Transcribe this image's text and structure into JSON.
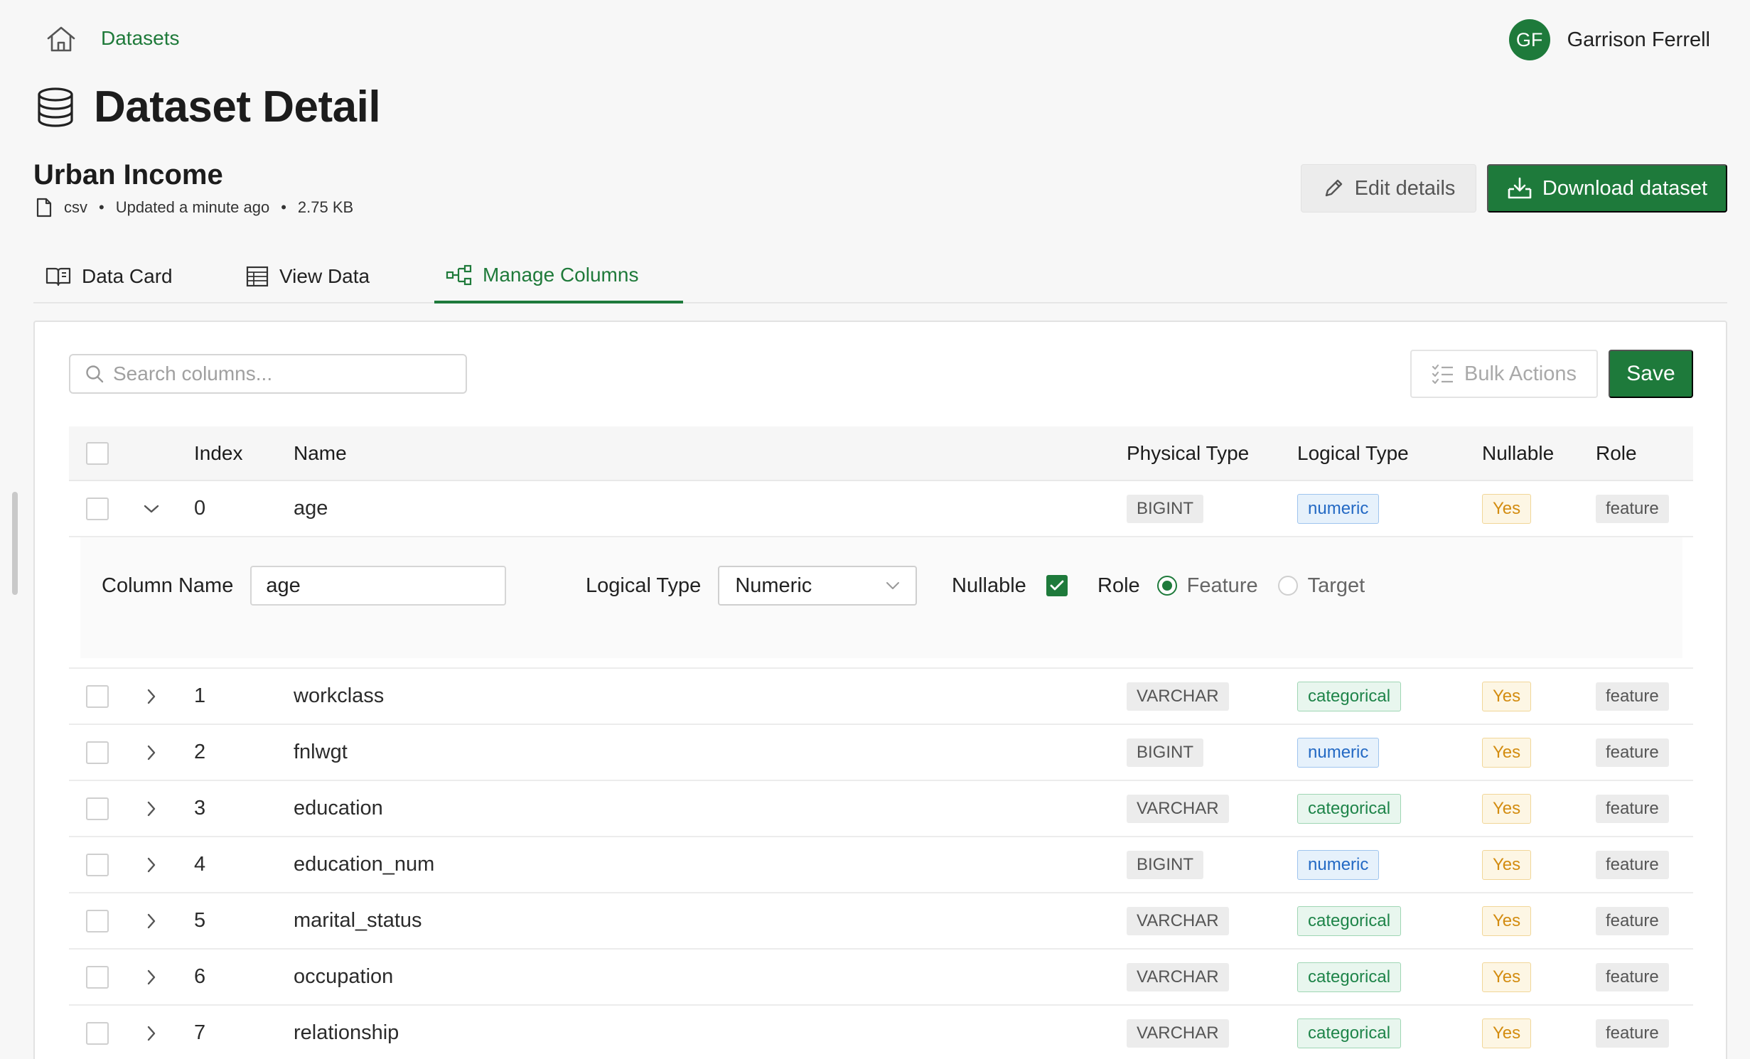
{
  "nav": {
    "breadcrumb": "Datasets"
  },
  "user": {
    "initials": "GF",
    "name": "Garrison Ferrell"
  },
  "page": {
    "title": "Dataset Detail"
  },
  "dataset": {
    "name": "Urban Income",
    "format": "csv",
    "updated": "Updated a minute ago",
    "size": "2.75 KB"
  },
  "actions": {
    "edit_label": "Edit details",
    "download_label": "Download dataset"
  },
  "tabs": [
    {
      "label": "Data Card"
    },
    {
      "label": "View Data"
    },
    {
      "label": "Manage Columns"
    }
  ],
  "toolbar": {
    "search_placeholder": "Search columns...",
    "bulk_label": "Bulk Actions",
    "save_label": "Save"
  },
  "table": {
    "headers": {
      "index": "Index",
      "name": "Name",
      "physical": "Physical Type",
      "logical": "Logical Type",
      "nullable": "Nullable",
      "role": "Role"
    },
    "rows": [
      {
        "index": "0",
        "name": "age",
        "physical": "BIGINT",
        "logical": "numeric",
        "nullable": "Yes",
        "role": "feature",
        "expanded": true
      },
      {
        "index": "1",
        "name": "workclass",
        "physical": "VARCHAR",
        "logical": "categorical",
        "nullable": "Yes",
        "role": "feature"
      },
      {
        "index": "2",
        "name": "fnlwgt",
        "physical": "BIGINT",
        "logical": "numeric",
        "nullable": "Yes",
        "role": "feature"
      },
      {
        "index": "3",
        "name": "education",
        "physical": "VARCHAR",
        "logical": "categorical",
        "nullable": "Yes",
        "role": "feature"
      },
      {
        "index": "4",
        "name": "education_num",
        "physical": "BIGINT",
        "logical": "numeric",
        "nullable": "Yes",
        "role": "feature"
      },
      {
        "index": "5",
        "name": "marital_status",
        "physical": "VARCHAR",
        "logical": "categorical",
        "nullable": "Yes",
        "role": "feature"
      },
      {
        "index": "6",
        "name": "occupation",
        "physical": "VARCHAR",
        "logical": "categorical",
        "nullable": "Yes",
        "role": "feature"
      },
      {
        "index": "7",
        "name": "relationship",
        "physical": "VARCHAR",
        "logical": "categorical",
        "nullable": "Yes",
        "role": "feature"
      }
    ]
  },
  "editor": {
    "column_name_label": "Column Name",
    "column_name_value": "age",
    "logical_type_label": "Logical Type",
    "logical_type_value": "Numeric",
    "nullable_label": "Nullable",
    "nullable_checked": true,
    "role_label": "Role",
    "role_options": [
      "Feature",
      "Target"
    ],
    "role_selected": "Feature"
  },
  "colors": {
    "accent": "#1e7a3b",
    "numeric": "#2369c4",
    "categorical": "#1e8449",
    "nullable_yes": "#d38c10"
  }
}
